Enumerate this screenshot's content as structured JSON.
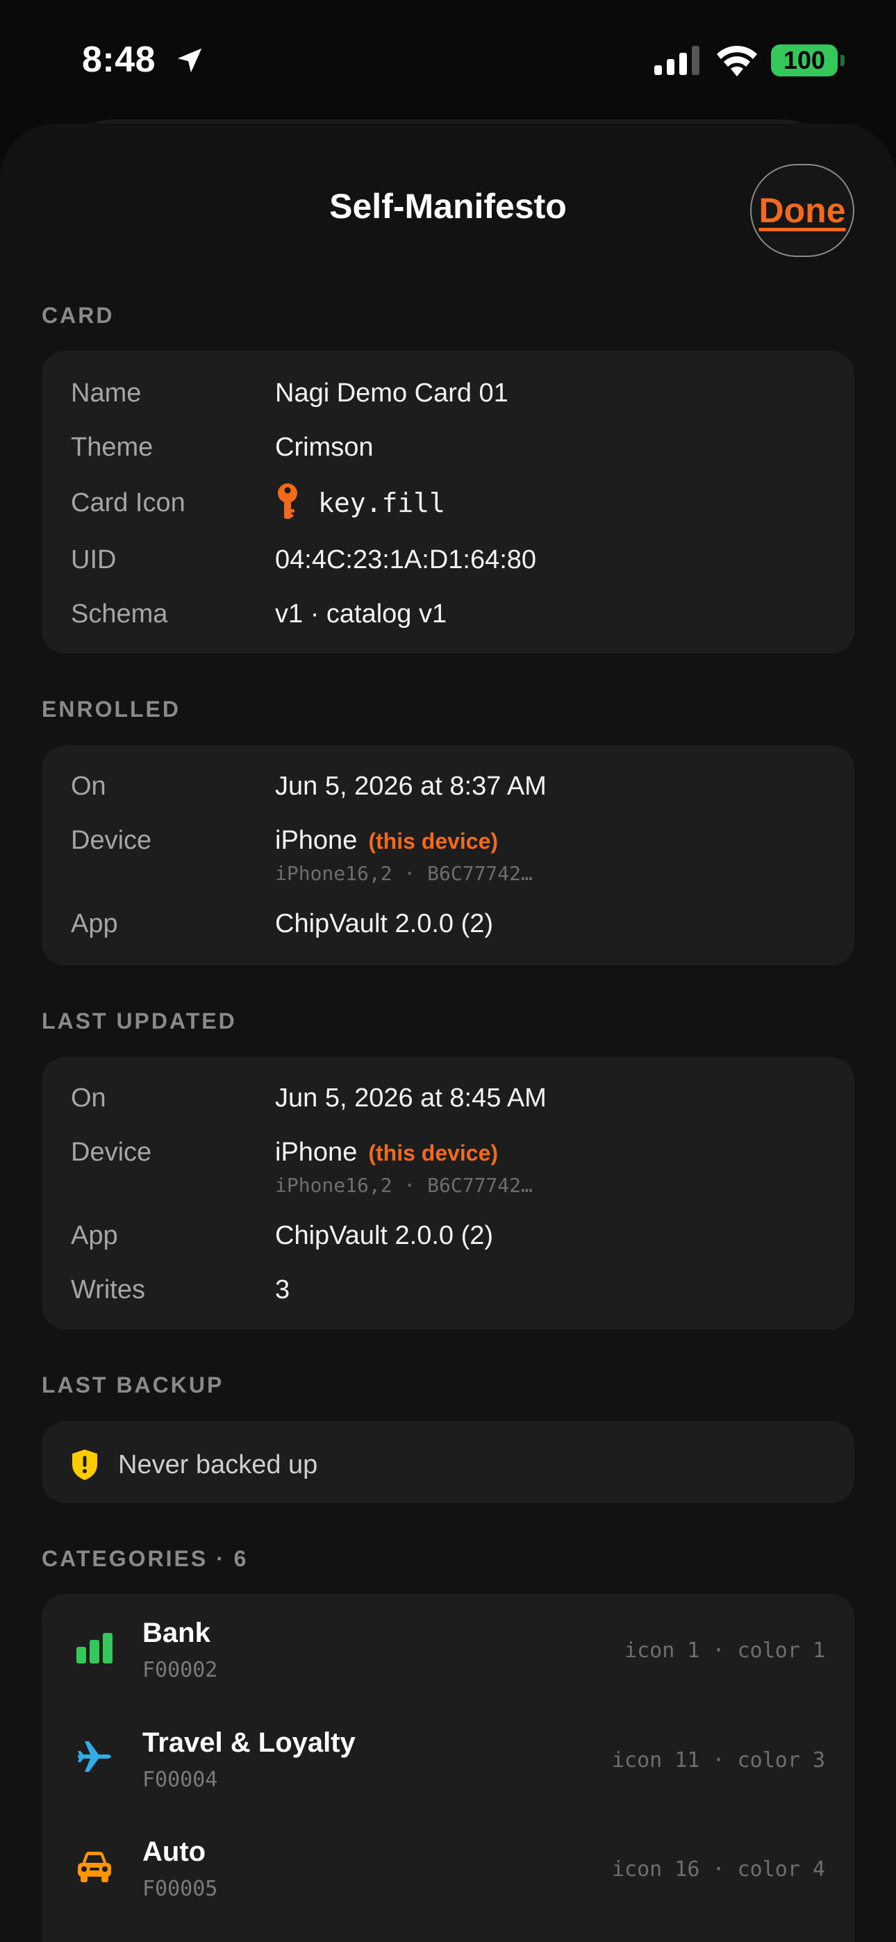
{
  "status_bar": {
    "time": "8:48",
    "battery": "100"
  },
  "header": {
    "title": "Self-Manifesto",
    "done_label": "Done"
  },
  "colors": {
    "accent": "#f26a1b",
    "battery_green": "#34c759",
    "warning_yellow": "#ffcc00",
    "bank_green": "#34c759",
    "travel_cyan": "#32ade6",
    "auto_orange": "#ff9500"
  },
  "card": {
    "header": "CARD",
    "rows": [
      {
        "label": "Name",
        "value": "Nagi Demo Card 01"
      },
      {
        "label": "Theme",
        "value": "Crimson"
      },
      {
        "label": "Card Icon",
        "value": "key.fill",
        "icon": "key-icon"
      },
      {
        "label": "UID",
        "value": "04:4C:23:1A:D1:64:80"
      },
      {
        "label": "Schema",
        "value": "v1 · catalog v1"
      }
    ]
  },
  "enrolled": {
    "header": "ENROLLED",
    "on_label": "On",
    "on_value": "Jun 5, 2026 at 8:37 AM",
    "device_label": "Device",
    "device_value": "iPhone",
    "device_tag": "(this device)",
    "device_sub": "iPhone16,2 · B6C77742…",
    "app_label": "App",
    "app_value": "ChipVault 2.0.0 (2)"
  },
  "last_updated": {
    "header": "LAST UPDATED",
    "on_label": "On",
    "on_value": "Jun 5, 2026 at 8:45 AM",
    "device_label": "Device",
    "device_value": "iPhone",
    "device_tag": "(this device)",
    "device_sub": "iPhone16,2 · B6C77742…",
    "app_label": "App",
    "app_value": "ChipVault 2.0.0 (2)",
    "writes_label": "Writes",
    "writes_value": "3"
  },
  "last_backup": {
    "header": "LAST BACKUP",
    "text": "Never backed up",
    "icon": "warning-shield-icon"
  },
  "categories": {
    "header": "CATEGORIES · 6",
    "items": [
      {
        "name": "Bank",
        "code": "F00002",
        "meta": "icon 1 · color 1",
        "icon": "bank-chart-icon"
      },
      {
        "name": "Travel & Loyalty",
        "code": "F00004",
        "meta": "icon 11 · color 3",
        "icon": "airplane-icon"
      },
      {
        "name": "Auto",
        "code": "F00005",
        "meta": "icon 16 · color 4",
        "icon": "car-icon"
      }
    ]
  }
}
